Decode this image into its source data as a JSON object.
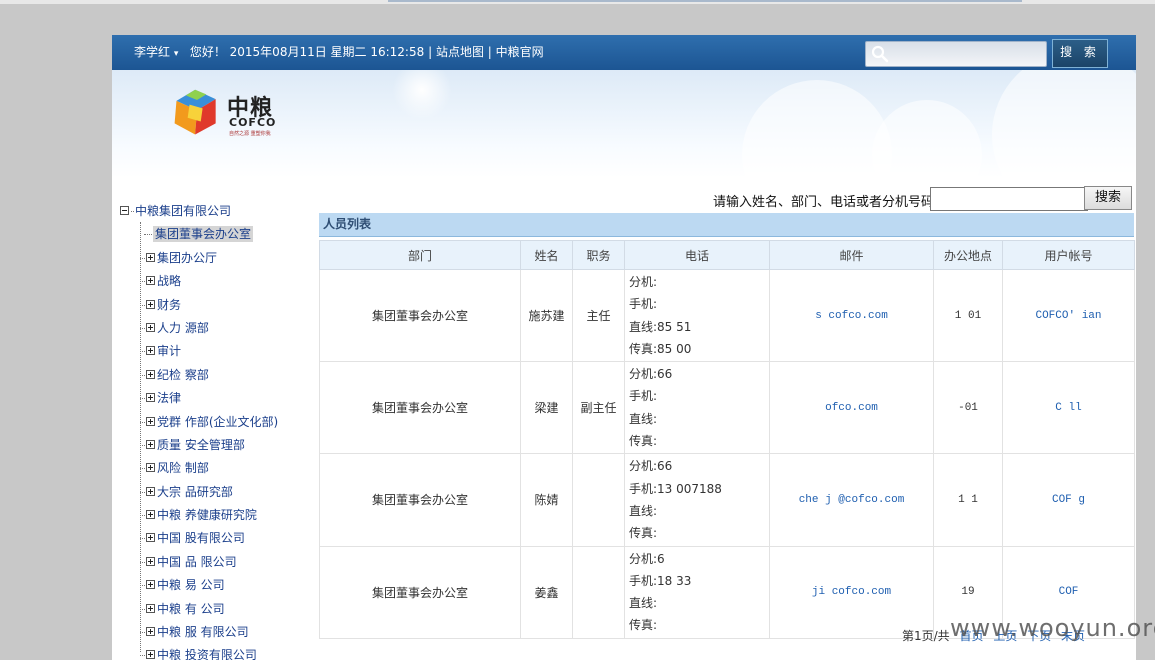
{
  "header": {
    "user_name": "李学红",
    "user_caret": "▾",
    "greeting": "您好！ 2015年08月11日 星期二 16:12:58",
    "sep1": "|",
    "sitemap_link": "站点地图",
    "sep2": "|",
    "official_link": "中粮官网",
    "search_placeholder": "",
    "search_button": "搜 索",
    "bar_color": "#1c5593"
  },
  "logo": {
    "cn": "中粮",
    "en": "COFCO",
    "slogan": "自然之源 重塑你我"
  },
  "tree": {
    "root": "中粮集团有限公司",
    "selected": "集团董事会办公室",
    "items": [
      "集团办公厅",
      "战略",
      "财务",
      "人力 源部",
      "审计",
      "纪检 察部",
      "法律",
      "党群 作部(企业文化部)",
      "质量 安全管理部",
      "风险 制部",
      "大宗 品研究部",
      "中粮 养健康研究院",
      "中国 股有限公司",
      "中国 品 限公司",
      "中粮 易 公司",
      "中粮 有 公司",
      "中粮 服 有限公司",
      "中粮 投资有限公司"
    ]
  },
  "search": {
    "label": "请输入姓名、部门、电话或者分机号码:",
    "value": "",
    "button": "搜索"
  },
  "list": {
    "title": "人员列表",
    "columns": [
      "部门",
      "姓名",
      "职务",
      "电话",
      "邮件",
      "办公地点",
      "用户帐号"
    ],
    "rows": [
      {
        "dept": "集团董事会办公室",
        "name": "施苏建",
        "title": "主任",
        "ext": "分机:",
        "mobile": "手机:",
        "direct": "直线:85     51",
        "fax": "传真:85     00",
        "email": "s      cofco.com",
        "office": "1    01",
        "account": "COFCO'      ian"
      },
      {
        "dept": "集团董事会办公室",
        "name": "梁建",
        "title": "副主任",
        "ext": "分机:66",
        "mobile": "手机:",
        "direct": "直线:",
        "fax": "传真:",
        "email": "   ofco.com",
        "office": "  -01",
        "account": "C      ll"
      },
      {
        "dept": "集团董事会办公室",
        "name": "陈婧",
        "title": "",
        "ext": "分机:66",
        "mobile": "手机:13    007188",
        "direct": "直线:",
        "fax": "传真:",
        "email": "che  j    @cofco.com",
        "office": "1    1",
        "account": "COF       g"
      },
      {
        "dept": "集团董事会办公室",
        "name": "姜鑫",
        "title": "",
        "ext": "分机:6",
        "mobile": "手机:18      33",
        "direct": "直线:",
        "fax": "传真:",
        "email": "ji     cofco.com",
        "office": "19",
        "account": "COF"
      }
    ]
  },
  "pager": {
    "text": "第1页/共",
    "first": "首页",
    "prev": "上页",
    "next": "下页",
    "last": "末页"
  },
  "watermark": "www.wooyun.org"
}
